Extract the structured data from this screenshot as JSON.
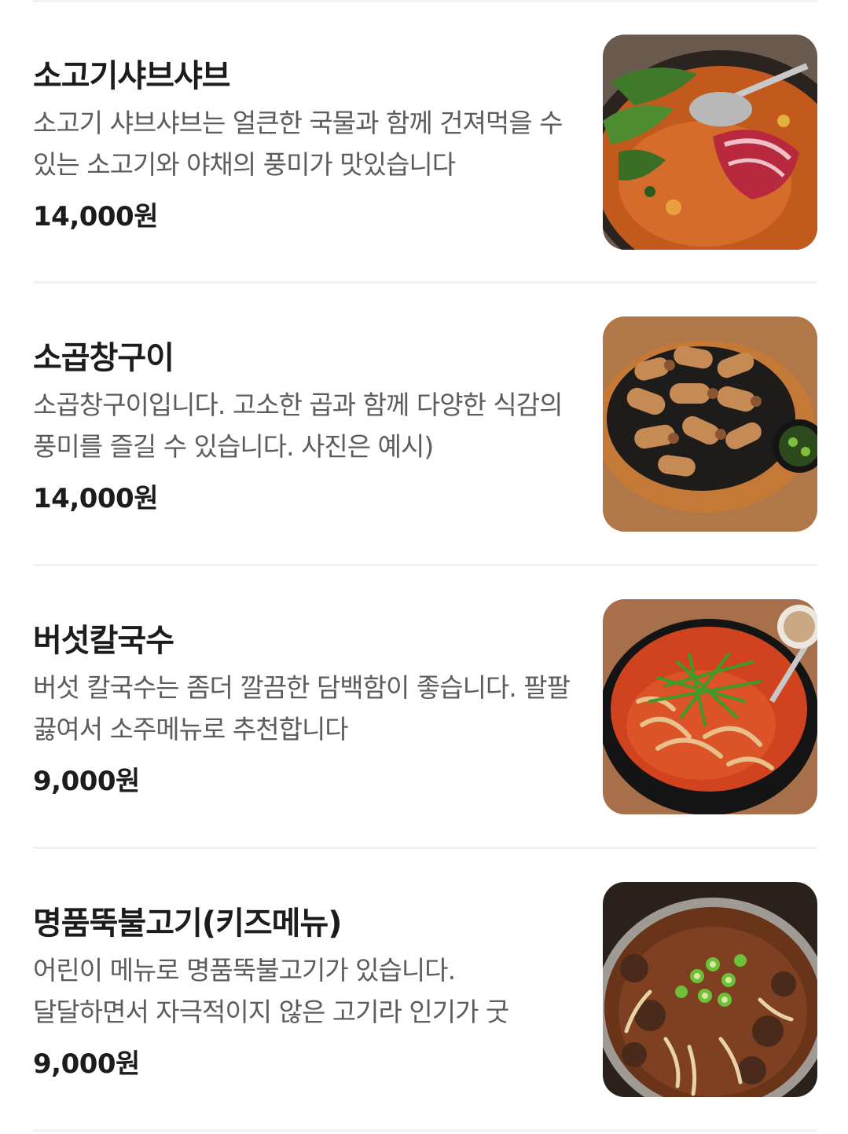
{
  "menu": {
    "items": [
      {
        "name": "소고기샤브샤브",
        "description": "소고기 샤브샤브는 얼큰한 국물과 함께 건져먹을 수 있는 소고기와 야채의 풍미가 맛있습니다",
        "price": "14,000원",
        "photo": "shabu-shabu-photo"
      },
      {
        "name": "소곱창구이",
        "description": "소곱창구이입니다. 고소한 곱과 함께 다양한 식감의 풍미를 즐길 수 있습니다. 사진은 예시)",
        "price": "14,000원",
        "photo": "grilled-gopchang-photo"
      },
      {
        "name": "버섯칼국수",
        "description": "버섯 칼국수는 좀더 깔끔한 담백함이 좋습니다. 팔팔 끓여서 소주메뉴로 추천합니다",
        "price": "9,000원",
        "photo": "mushroom-kalguksu-photo"
      },
      {
        "name": "명품뚝불고기(키즈메뉴)",
        "description": "어린이 메뉴로 명품뚝불고기가 있습니다. 달달하면서 자극적이지 않은 고기라 인기가 굿",
        "price": "9,000원",
        "photo": "ttukbulgogi-photo"
      }
    ]
  },
  "colors": {
    "text_primary": "#1c1c1c",
    "text_secondary": "#5c5c5c",
    "divider": "#f1f1f1",
    "background": "#ffffff"
  }
}
